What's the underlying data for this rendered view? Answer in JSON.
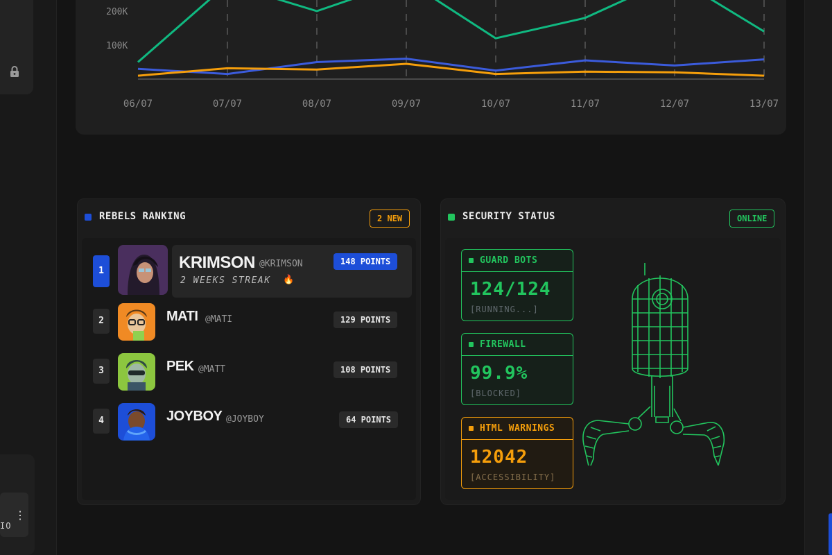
{
  "chart_data": {
    "type": "line",
    "x": [
      "06/07",
      "07/07",
      "08/07",
      "09/07",
      "10/07",
      "11/07",
      "12/07",
      "13/07"
    ],
    "yticks": [
      "100K",
      "200K"
    ],
    "series": [
      {
        "color": "#10b981",
        "values": [
          50000,
          280000,
          200000,
          290000,
          120000,
          180000,
          300000,
          140000
        ]
      },
      {
        "color": "#3b5bdb",
        "values": [
          30000,
          15000,
          50000,
          60000,
          25000,
          55000,
          40000,
          58000
        ]
      },
      {
        "color": "#f59e0b",
        "values": [
          10000,
          32000,
          28000,
          45000,
          15000,
          22000,
          20000,
          10000
        ]
      }
    ]
  },
  "ranking": {
    "title": "REBELS RANKING",
    "badge": "2 NEW",
    "accent": "#1d4ed8",
    "rows": [
      {
        "rank": "1",
        "name": "KRIMSON",
        "handle": "@KRIMSON",
        "streak": "2 WEEKS STREAK",
        "points": "148 POINTS"
      },
      {
        "rank": "2",
        "name": "MATI",
        "handle": "@MATI",
        "points": "129 POINTS"
      },
      {
        "rank": "3",
        "name": "PEK",
        "handle": "@MATT",
        "points": "108 POINTS"
      },
      {
        "rank": "4",
        "name": "JOYBOY",
        "handle": "@JOYBOY",
        "points": "64 POINTS"
      }
    ]
  },
  "security": {
    "title": "SECURITY STATUS",
    "badge": "ONLINE",
    "accent": "#22c55e",
    "warn_color": "#f59e0b",
    "cards": [
      {
        "label": "GUARD BOTS",
        "value": "124/124",
        "sub": "[RUNNING...]"
      },
      {
        "label": "FIREWALL",
        "value": "99.9%",
        "sub": "[BLOCKED]"
      },
      {
        "label": "HTML WARNINGS",
        "value": "12042",
        "sub": "[ACCESSIBILITY]"
      }
    ]
  },
  "sidebar": {
    "bottom_item_text": "IO"
  }
}
